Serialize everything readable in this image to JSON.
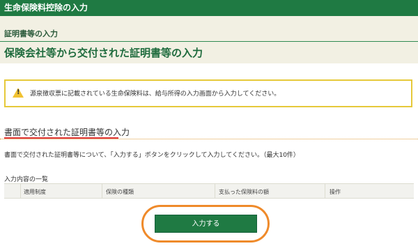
{
  "header": {
    "title": "生命保険料控除の入力"
  },
  "section": {
    "subtitle": "証明書等の入力",
    "title": "保険会社等から交付された証明書等の入力"
  },
  "notice": {
    "icon": "warning-icon",
    "text": "源泉徴収票に記載されている生命保険料は、給与所得の入力画面から入力してください。"
  },
  "paper_input": {
    "heading": "書面で交付された証明書等の入力",
    "description": "書面で交付された証明書等について、「入力する」ボタンをクリックして入力してください。（最大10件）"
  },
  "list": {
    "label": "入力内容の一覧",
    "columns": [
      "適用制度",
      "保険の種類",
      "支払った保険料の額",
      "操作"
    ]
  },
  "actions": {
    "input_button": "入力する"
  },
  "colors": {
    "brand_green": "#1f7a43",
    "highlight_orange": "#ef8a2a",
    "underline_red": "#dd3333"
  }
}
